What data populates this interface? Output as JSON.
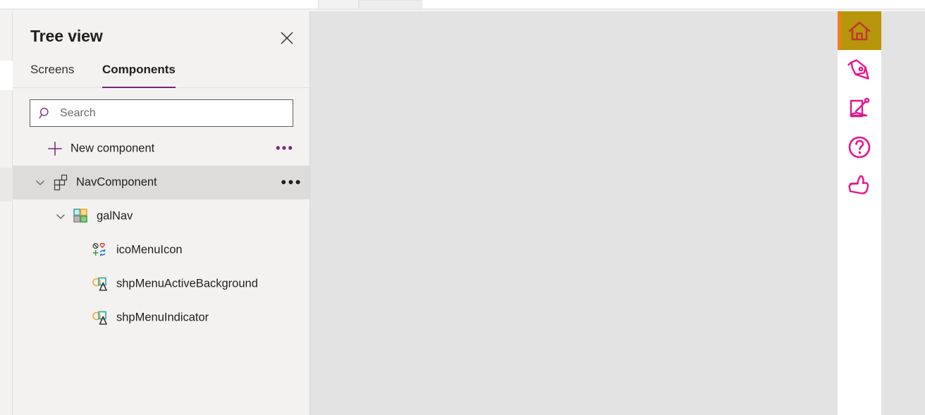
{
  "window": {
    "top_chrome": {
      "tab_stub_a": "",
      "tab_stub_b": ""
    }
  },
  "colors": {
    "accent_purple": "#742774",
    "panel_bg": "#f3f2f1",
    "row_selected": "#dedcda",
    "canvas_bg": "#e3e3e3",
    "nav_active_bg": "#b8960c",
    "nav_indicator": "#f07c20",
    "nav_icon_magenta": "#e3138c",
    "nav_active_icon": "#c0392b"
  },
  "panel": {
    "title": "Tree view",
    "close_icon": "close-icon",
    "tabs": [
      {
        "label": "Screens",
        "active": false
      },
      {
        "label": "Components",
        "active": true
      }
    ],
    "search": {
      "placeholder": "Search",
      "value": "",
      "icon": "search-icon"
    },
    "new_component": {
      "label": "New component",
      "icon": "plus-icon",
      "overflow": "•••"
    },
    "tree": [
      {
        "label": "NavComponent",
        "depth": 0,
        "icon": "component-icon",
        "expanded": true,
        "selected": true,
        "overflow": "•••"
      },
      {
        "label": "galNav",
        "depth": 1,
        "icon": "gallery-icon",
        "expanded": true,
        "selected": false,
        "overflow": ""
      },
      {
        "label": "icoMenuIcon",
        "depth": 2,
        "icon": "icon-control-icon",
        "expanded": null,
        "selected": false,
        "overflow": ""
      },
      {
        "label": "shpMenuActiveBackground",
        "depth": 2,
        "icon": "shape-icon",
        "expanded": null,
        "selected": false,
        "overflow": ""
      },
      {
        "label": "shpMenuIndicator",
        "depth": 2,
        "icon": "shape-icon",
        "expanded": null,
        "selected": false,
        "overflow": ""
      }
    ]
  },
  "nav_preview": {
    "items": [
      {
        "icon": "home-icon",
        "active": true
      },
      {
        "icon": "pen-icon",
        "active": false
      },
      {
        "icon": "edit-square-icon",
        "active": false
      },
      {
        "icon": "help-circle-icon",
        "active": false
      },
      {
        "icon": "thumbs-up-icon",
        "active": false
      }
    ]
  }
}
